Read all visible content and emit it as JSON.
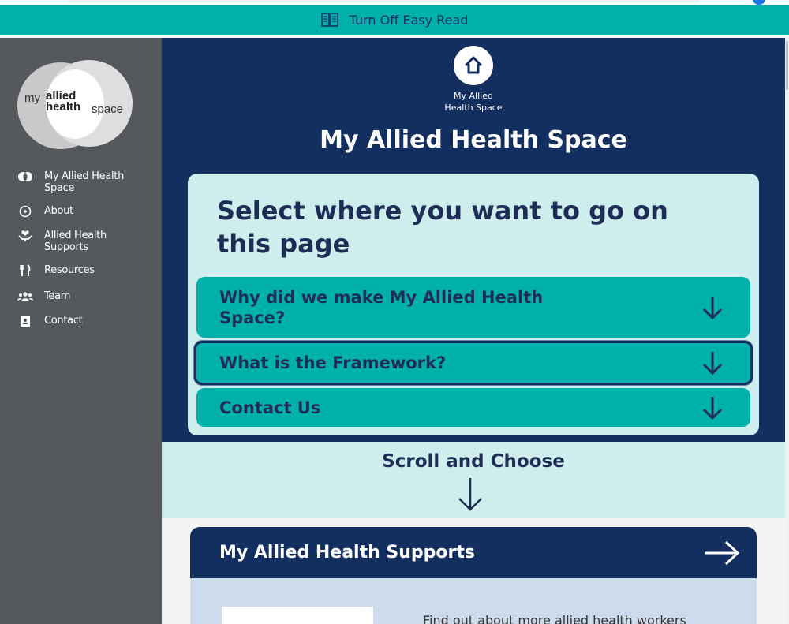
{
  "easy_read_bar": {
    "label": "Turn Off Easy Read",
    "icon": "book-icon"
  },
  "sidebar": {
    "logo": {
      "my": "my",
      "allied": "allied",
      "health": "health",
      "space": "space"
    },
    "items": [
      {
        "label": "My Allied Health Space",
        "icon": "venn-circles-icon"
      },
      {
        "label": "About",
        "icon": "info-circle-icon"
      },
      {
        "label": "Allied Health Supports",
        "icon": "hands-heart-icon"
      },
      {
        "label": "Resources",
        "icon": "fork-knife-icon"
      },
      {
        "label": "Team",
        "icon": "people-icon"
      },
      {
        "label": "Contact",
        "icon": "contact-card-icon"
      }
    ]
  },
  "hero": {
    "home_label_line1": "My Allied",
    "home_label_line2": "Health Space",
    "title": "My Allied Health Space"
  },
  "select_card": {
    "heading": "Select where you want to go on this page",
    "links": [
      {
        "label": "Why did we make My Allied Health Space?"
      },
      {
        "label": "What is the Framework?"
      },
      {
        "label": "Contact Us"
      }
    ]
  },
  "scroll_band": {
    "label": "Scroll and Choose"
  },
  "supports_card": {
    "title": "My Allied Health Supports",
    "description": "Find out about more allied health workers"
  },
  "colors": {
    "teal": "#00b0aa",
    "navy": "#132f60",
    "light_teal": "#cdeeed",
    "sidebar_gray": "#55595d",
    "text_navy": "#1d2d55"
  }
}
